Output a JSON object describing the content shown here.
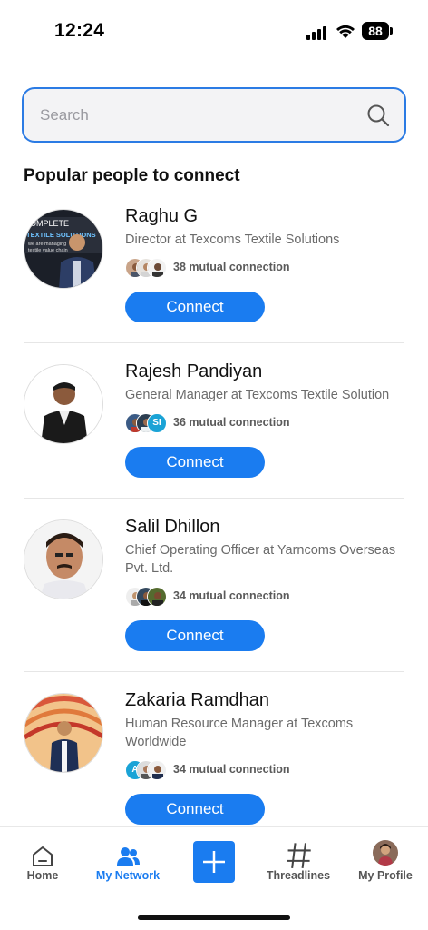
{
  "status_bar": {
    "time": "12:24",
    "battery": "88"
  },
  "search": {
    "placeholder": "Search"
  },
  "section_title": "Popular people to connect",
  "people": [
    {
      "name": "Raghu G",
      "title": "Director at Texcoms Textile Solutions",
      "mutual": "38 mutual connection",
      "button": "Connect"
    },
    {
      "name": "Rajesh Pandiyan",
      "title": "General Manager at Texcoms Textile Solution",
      "mutual": "36 mutual connection",
      "button": "Connect",
      "mini_initials": "SI"
    },
    {
      "name": "Salil Dhillon",
      "title": "Chief Operating Officer at Yarncoms Overseas Pvt. Ltd.",
      "mutual": "34 mutual connection",
      "button": "Connect"
    },
    {
      "name": "Zakaria Ramdhan",
      "title": "Human Resource Manager at Texcoms Worldwide",
      "mutual": "34 mutual connection",
      "button": "Connect",
      "mini_initials": "A"
    }
  ],
  "avatar_text": {
    "line1": "OMPLETE",
    "line2": "TEXTILE SOLUTIONS",
    "line3": "we are managing",
    "line4": "textile value chain"
  },
  "nav": [
    {
      "label": "Home",
      "icon": "home-icon"
    },
    {
      "label": "My Network",
      "icon": "network-icon",
      "active": true
    },
    {
      "label": "",
      "icon": "plus-icon"
    },
    {
      "label": "Threadlines",
      "icon": "hash-icon"
    },
    {
      "label": "My Profile",
      "icon": "profile-avatar"
    }
  ],
  "colors": {
    "accent": "#1a7cf0",
    "search_border": "#2b7be4"
  }
}
